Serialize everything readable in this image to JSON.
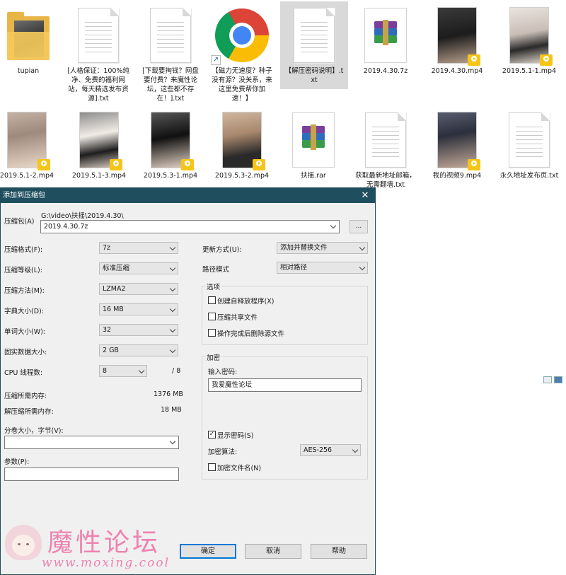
{
  "files": [
    {
      "name": "tupian",
      "type": "folder",
      "icon": "folder-icon"
    },
    {
      "name": "[人格保证：100%纯净、免费的福利网站，每天精选发布资源].txt",
      "type": "txt",
      "icon": "text-file-icon"
    },
    {
      "name": "[下载要掏钱？网盘要付费？来魔性论坛，这些都不存在！].txt",
      "type": "txt",
      "icon": "text-file-icon"
    },
    {
      "name": "【磁力无速度？种子没有源？没关系，来这里免费帮你加速！】",
      "type": "shortcut",
      "icon": "chrome-icon"
    },
    {
      "name": "【解压密码说明】.txt",
      "type": "txt",
      "icon": "text-file-icon",
      "selected": true
    },
    {
      "name": "2019.4.30.7z",
      "type": "archive",
      "icon": "winrar-icon"
    },
    {
      "name": "2019.4.30.mp4",
      "type": "video",
      "icon": "video-thumbnail"
    },
    {
      "name": "2019.5.1-1.mp4",
      "type": "video",
      "icon": "video-thumbnail"
    },
    {
      "name": "2019.5.1-2.mp4",
      "type": "video",
      "icon": "video-thumbnail"
    },
    {
      "name": "2019.5.1-3.mp4",
      "type": "video",
      "icon": "video-thumbnail"
    },
    {
      "name": "2019.5.3-1.mp4",
      "type": "video",
      "icon": "video-thumbnail"
    },
    {
      "name": "2019.5.3-2.mp4",
      "type": "video",
      "icon": "video-thumbnail"
    },
    {
      "name": "扶摇.rar",
      "type": "archive",
      "icon": "winrar-icon"
    },
    {
      "name": "获取最新地址邮箱，无需翻墙.txt",
      "type": "txt",
      "icon": "text-file-icon"
    },
    {
      "name": "我的视频9.mp4",
      "type": "video",
      "icon": "video-thumbnail"
    },
    {
      "name": "永久地址发布页.txt",
      "type": "txt",
      "icon": "text-file-icon"
    }
  ],
  "dialog": {
    "title": "添加到压缩包",
    "archive_label": "压缩包(A)",
    "archive_path": "G:\\video\\扶摇\\2019.4.30\\",
    "archive_name": "2019.4.30.7z",
    "browse_label": "...",
    "format_label": "压缩格式(F):",
    "format_value": "7z",
    "level_label": "压缩等级(L):",
    "level_value": "标准压缩",
    "method_label": "压缩方法(M):",
    "method_value": "LZMA2",
    "dict_label": "字典大小(D):",
    "dict_value": "16 MB",
    "word_label": "单词大小(W):",
    "word_value": "32",
    "solid_label": "固实数据大小:",
    "solid_value": "2 GB",
    "cpu_label": "CPU 线程数:",
    "cpu_value": "8",
    "cpu_total": "/ 8",
    "mem_compress_label": "压缩所需内存:",
    "mem_compress_value": "1376 MB",
    "mem_decompress_label": "解压缩所需内存:",
    "mem_decompress_value": "18 MB",
    "split_label": "分卷大小，字节(V):",
    "split_value": "",
    "params_label": "参数(P):",
    "params_value": "",
    "update_label": "更新方式(U):",
    "update_value": "添加并替换文件",
    "path_label": "路径模式",
    "path_value": "相对路径",
    "options_title": "选项",
    "opt_sfx": "创建自释放程序(X)",
    "opt_sfx_checked": false,
    "opt_shared": "压缩共享文件",
    "opt_shared_checked": false,
    "opt_delete": "操作完成后删除源文件",
    "opt_delete_checked": false,
    "encrypt_title": "加密",
    "password_label": "输入密码:",
    "password_value": "我爱魔性论坛",
    "show_password": "显示密码(S)",
    "show_password_checked": true,
    "encrypt_method_label": "加密算法:",
    "encrypt_method_value": "AES-256",
    "encrypt_names": "加密文件名(N)",
    "encrypt_names_checked": false,
    "ok": "确定",
    "cancel": "取消",
    "help": "帮助",
    "check_mark": "✓"
  },
  "watermark": {
    "text": "魔性论坛",
    "url": "www.moxing.cool"
  },
  "colors": {
    "titlebar": "#1f4f5f",
    "selection": "#d9d9d9",
    "watermark": "#ee82b0"
  }
}
